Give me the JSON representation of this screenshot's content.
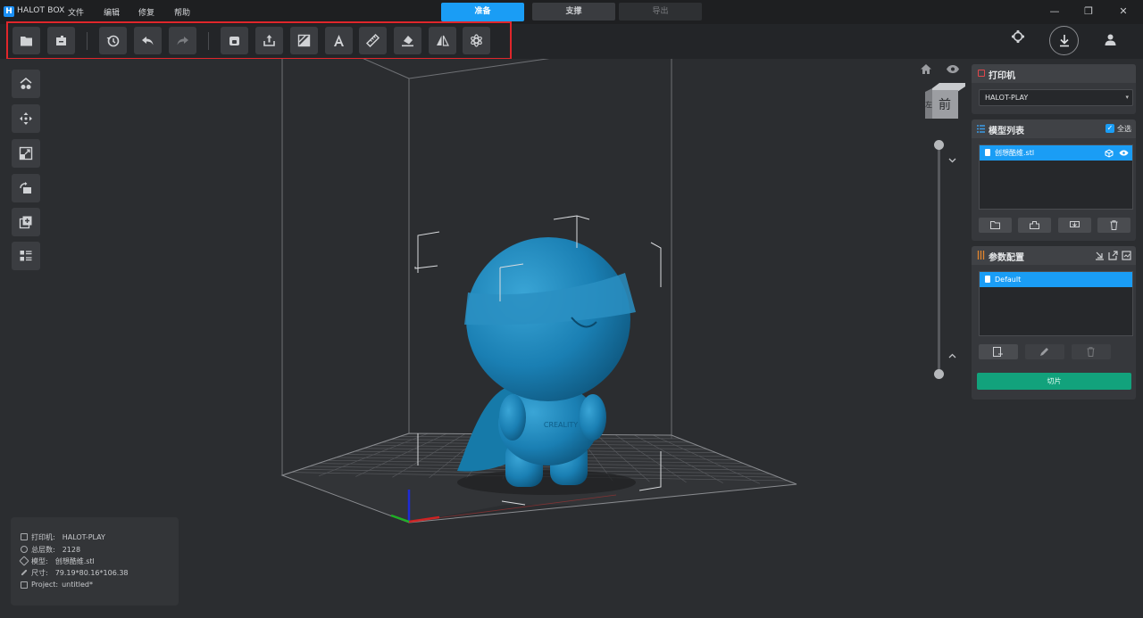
{
  "titlebar": {
    "app_logo": "H",
    "app_name": "HALOT BOX",
    "menus": [
      "文件",
      "编辑",
      "修复",
      "帮助"
    ],
    "mode_tabs": [
      "准备",
      "支撑",
      "导出"
    ],
    "minimize": "—",
    "restore": "❐",
    "close": "✕"
  },
  "toolbar": {
    "tools": [
      "open-folder-icon",
      "import-icon",
      "history-icon",
      "undo-icon",
      "redo-icon",
      "package-icon",
      "export-icon",
      "hollow-icon",
      "text-icon",
      "measure-icon",
      "fill-icon",
      "mirror-icon",
      "settings-icon"
    ]
  },
  "viewport": {
    "cube_face_front": "前",
    "cube_face_left": "左",
    "model_text": "CREALITY"
  },
  "info": {
    "printer_label": "打印机:",
    "printer_value": "HALOT-PLAY",
    "layers_label": "总层数:",
    "layers_value": "2128",
    "model_label": "模型:",
    "model_value": "创想酷维.stl",
    "size_label": "尺寸:",
    "size_value": "79.19*80.16*106.38",
    "project_label": "Project:",
    "project_value": "untitled*"
  },
  "printer_panel": {
    "title": "打印机",
    "selected": "HALOT-PLAY"
  },
  "model_list": {
    "title": "模型列表",
    "select_all": "全选",
    "items": [
      "创想酷维.stl"
    ]
  },
  "param_panel": {
    "title": "参数配置",
    "items": [
      "Default"
    ]
  },
  "slice_button": "切片",
  "colors": {
    "accent": "#1a9df5",
    "slice": "#12a27c",
    "model": "#1a7fb3",
    "highlight": "#e0262b"
  }
}
